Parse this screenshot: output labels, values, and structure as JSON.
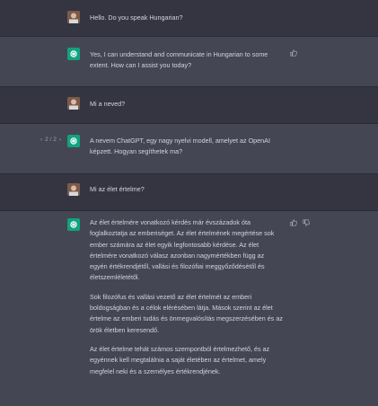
{
  "conversation": [
    {
      "role": "user",
      "text": "Hello. Do you speak Hungarian?"
    },
    {
      "role": "assistant",
      "text": "Yes, I can understand and communicate in Hungarian to some extent. How can I assist you today?"
    },
    {
      "role": "user",
      "text": "Mi a neved?"
    },
    {
      "role": "assistant",
      "pager": "2 / 2",
      "text": "A nevem ChatGPT, egy nagy nyelvi modell, amelyet az OpenAI képzett. Hogyan segíthetek ma?"
    },
    {
      "role": "user",
      "text": "Mi az élet értelme?"
    },
    {
      "role": "assistant",
      "paragraphs": [
        "Az élet értelmére vonatkozó kérdés már évszázadok óta foglalkoztatja az emberiséget. Az élet értelmének megértése sok ember számára az élet egyik legfontosabb kérdése. Az élet értelmére vonatkozó válasz azonban nagymértékben függ az egyén értékrendjétől, vallási és filozófiai meggyőződésétől és életszemléletétől.",
        "Sok filozófus és vallási vezető az élet értelmét az emberi boldogságban és a célok elérésében látja. Mások szerint az élet értelme az emberi tudás és önmegvalósítás megszerzésében és az örök életben keresendő.",
        "Az élet értelme tehát számos szempontból értelmezhető, és az egyénnek kell megtalálnia a saját életében az értelmet, amely megfelel neki és a személyes értékrendjének."
      ]
    }
  ],
  "icons": {
    "thumbs_up": "thumbs-up-icon",
    "thumbs_down": "thumbs-down-icon",
    "prev": "chevron-left-icon",
    "next": "chevron-right-icon",
    "bot_logo": "openai-logo-icon"
  },
  "colors": {
    "background": "#343541",
    "assistant_row": "#444654",
    "accent": "#10a37f"
  }
}
